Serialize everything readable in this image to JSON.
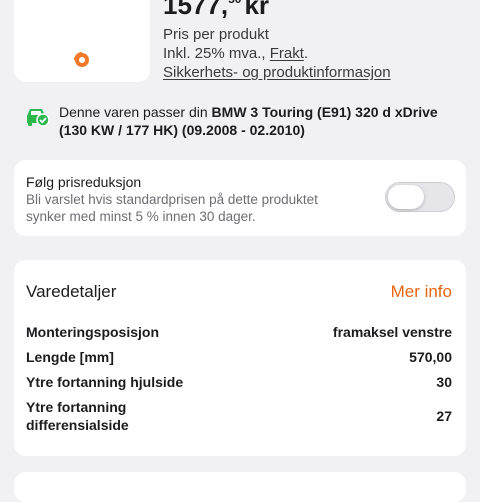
{
  "product": {
    "price_main": "1577,",
    "price_cents": "50",
    "price_currency": "kr",
    "per_product": "Pris per produkt",
    "vat_prefix": "Inkl. 25% mva., ",
    "shipping_link": "Frakt",
    "vat_suffix": ".",
    "safety_link": "Sikkerhets- og produktinformasjon",
    "badge_icon": "orange-discount-badge-icon"
  },
  "compatibility": {
    "prefix": "Denne varen passer din ",
    "vehicle": "BMW 3 Touring (E91) 320 d xDrive (130 KW / 177 HK) (09.2008 - 02.2010)",
    "icon": "car-check-icon",
    "icon_color": "#2db84d"
  },
  "price_alert": {
    "title": "Følg prisreduksjon",
    "description": "Bli varslet hvis standardprisen på dette produktet synker med minst 5 % innen 30 dager.",
    "enabled": false
  },
  "details": {
    "title": "Varedetaljer",
    "more_label": "Mer info",
    "accent_color": "#e8650f",
    "rows": [
      {
        "label": "Monteringsposisjon",
        "value": "framaksel venstre"
      },
      {
        "label": "Lengde [mm]",
        "value": "570,00"
      },
      {
        "label": "Ytre fortanning hjulside",
        "value": "30"
      },
      {
        "label": "Ytre fortanning differensialside",
        "value": "27"
      }
    ]
  }
}
